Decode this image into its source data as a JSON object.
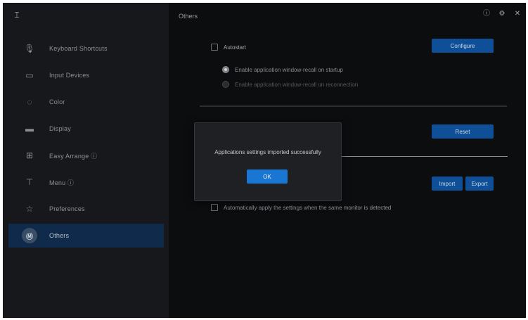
{
  "app": {
    "logo_glyph": "⌶"
  },
  "sidebar": {
    "items": [
      {
        "label": "Keyboard Shortcuts",
        "icon": "microphone-icon",
        "glyph": "🎙"
      },
      {
        "label": "Input Devices",
        "icon": "monitor-icon",
        "glyph": "▭"
      },
      {
        "label": "Color",
        "icon": "palette-icon",
        "glyph": "◌"
      },
      {
        "label": "Display",
        "icon": "display-icon",
        "glyph": "▬"
      },
      {
        "label": "Easy Arrange ⓘ",
        "icon": "grid-icon",
        "glyph": "⊞"
      },
      {
        "label": "Menu ⓘ",
        "icon": "menu-icon",
        "glyph": "⊤"
      },
      {
        "label": "Preferences",
        "icon": "star-icon",
        "glyph": "☆"
      },
      {
        "label": "Others",
        "icon": "others-icon",
        "glyph": "Ⓜ",
        "active": true
      }
    ]
  },
  "main": {
    "title": "Others",
    "window_controls": {
      "info": "ⓘ",
      "settings": "⚙",
      "close": "✕"
    },
    "section1": {
      "checkbox_label": "Autostart",
      "configure_button": "Configure",
      "radio1": "Enable application window-recall on startup",
      "radio2": "Enable application window-recall on reconnection"
    },
    "section2": {
      "reset_button": "Reset"
    },
    "section3": {
      "import_button": "Import",
      "export_button": "Export",
      "checkbox_label": "Automatically apply the settings when the same monitor is detected"
    }
  },
  "modal": {
    "message": "Applications settings imported successfully",
    "ok_label": "OK"
  },
  "colors": {
    "accent": "#1976d2",
    "button_blue": "#0f4f97",
    "sidebar_active": "#0f2a4a"
  }
}
